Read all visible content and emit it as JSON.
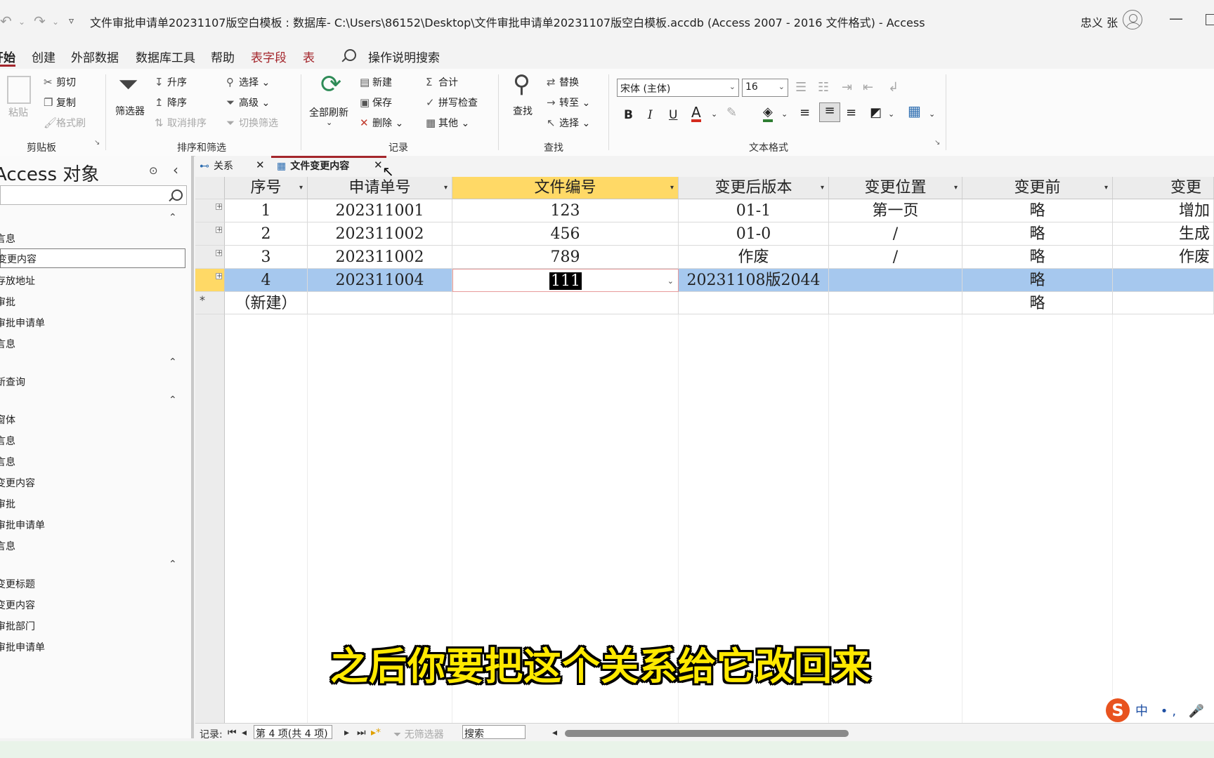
{
  "window": {
    "title": "文件审批申请单20231107版空白模板 : 数据库- C:\\Users\\86152\\Desktop\\文件审批申请单20231107版空白模板.accdb (Access 2007 - 2016 文件格式)  -  Access",
    "user": "忠义 张"
  },
  "menu": {
    "tabs": [
      "开始",
      "创建",
      "外部数据",
      "数据库工具",
      "帮助",
      "表字段",
      "表"
    ],
    "search": "操作说明搜索"
  },
  "ribbon": {
    "clipboard": {
      "paste": "粘贴",
      "cut": "剪切",
      "copy": "复制",
      "format_painter": "格式刷",
      "label": "剪贴板"
    },
    "sort_filter": {
      "filter": "筛选器",
      "asc": "升序",
      "desc": "降序",
      "remove_sort": "取消排序",
      "select": "选择",
      "advanced": "高级",
      "toggle_filter": "切换筛选",
      "label": "排序和筛选"
    },
    "records": {
      "refresh": "全部刷新",
      "new": "新建",
      "save": "保存",
      "delete": "删除",
      "totals": "合计",
      "spelling": "拼写检查",
      "more": "其他",
      "label": "记录"
    },
    "find": {
      "find": "查找",
      "replace": "替换",
      "goto": "转至",
      "select": "选择",
      "label": "查找"
    },
    "text_format": {
      "font": "宋体 (主体)",
      "size": "16",
      "bold": "B",
      "italic": "I",
      "underline": "U",
      "label": "文本格式"
    }
  },
  "nav": {
    "title": "Access 对象",
    "items": [
      "言息",
      "变更内容",
      "存放地址",
      "审批",
      "审批申请单",
      "言息",
      "新查询",
      "窗体",
      "言息",
      "言息",
      "变更内容",
      "审批",
      "审批申请单",
      "言息",
      "变更标题",
      "变更内容",
      "审批部门",
      "审批申请单"
    ]
  },
  "doc_tabs": [
    "关系",
    "文件变更内容"
  ],
  "table": {
    "columns": [
      "序号",
      "申请单号",
      "文件编号",
      "变更后版本",
      "变更位置",
      "变更前",
      "变更"
    ],
    "rows": [
      [
        "1",
        "202311001",
        "123",
        "01-1",
        "第一页",
        "略",
        "增加"
      ],
      [
        "2",
        "202311002",
        "456",
        "01-0",
        "/",
        "略",
        "生成"
      ],
      [
        "3",
        "202311002",
        "789",
        "作废",
        "/",
        "略",
        "作废"
      ],
      [
        "4",
        "202311004",
        "111",
        "20231108版2044",
        "",
        "略",
        ""
      ]
    ],
    "new_row": [
      "（新建）",
      "",
      "",
      "",
      "",
      "略",
      ""
    ]
  },
  "status": {
    "record_label": "记录:",
    "record_value": "第 4 项(共 4 项)",
    "no_filter": "无筛选器",
    "search": "搜索"
  },
  "subtitle": "之后你要把这个关系给它改回来",
  "ime": {
    "logo": "S",
    "text": "中 •, 🎤 ▦"
  },
  "colors": {
    "accent": "#a4262c",
    "selected_row": "#a6c8ee",
    "active_header": "#ffd966"
  }
}
